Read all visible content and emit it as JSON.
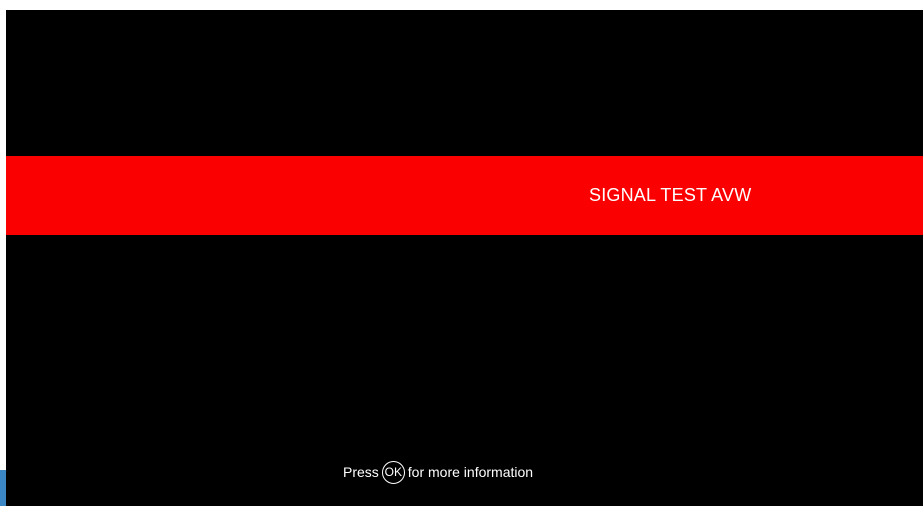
{
  "banner": {
    "label": "SIGNAL TEST AVW",
    "color": "#fb0000"
  },
  "hint": {
    "prefix": "Press",
    "key": "OK",
    "suffix": "for more information"
  },
  "colors": {
    "screen_background": "#000000",
    "text": "#ffffff"
  }
}
